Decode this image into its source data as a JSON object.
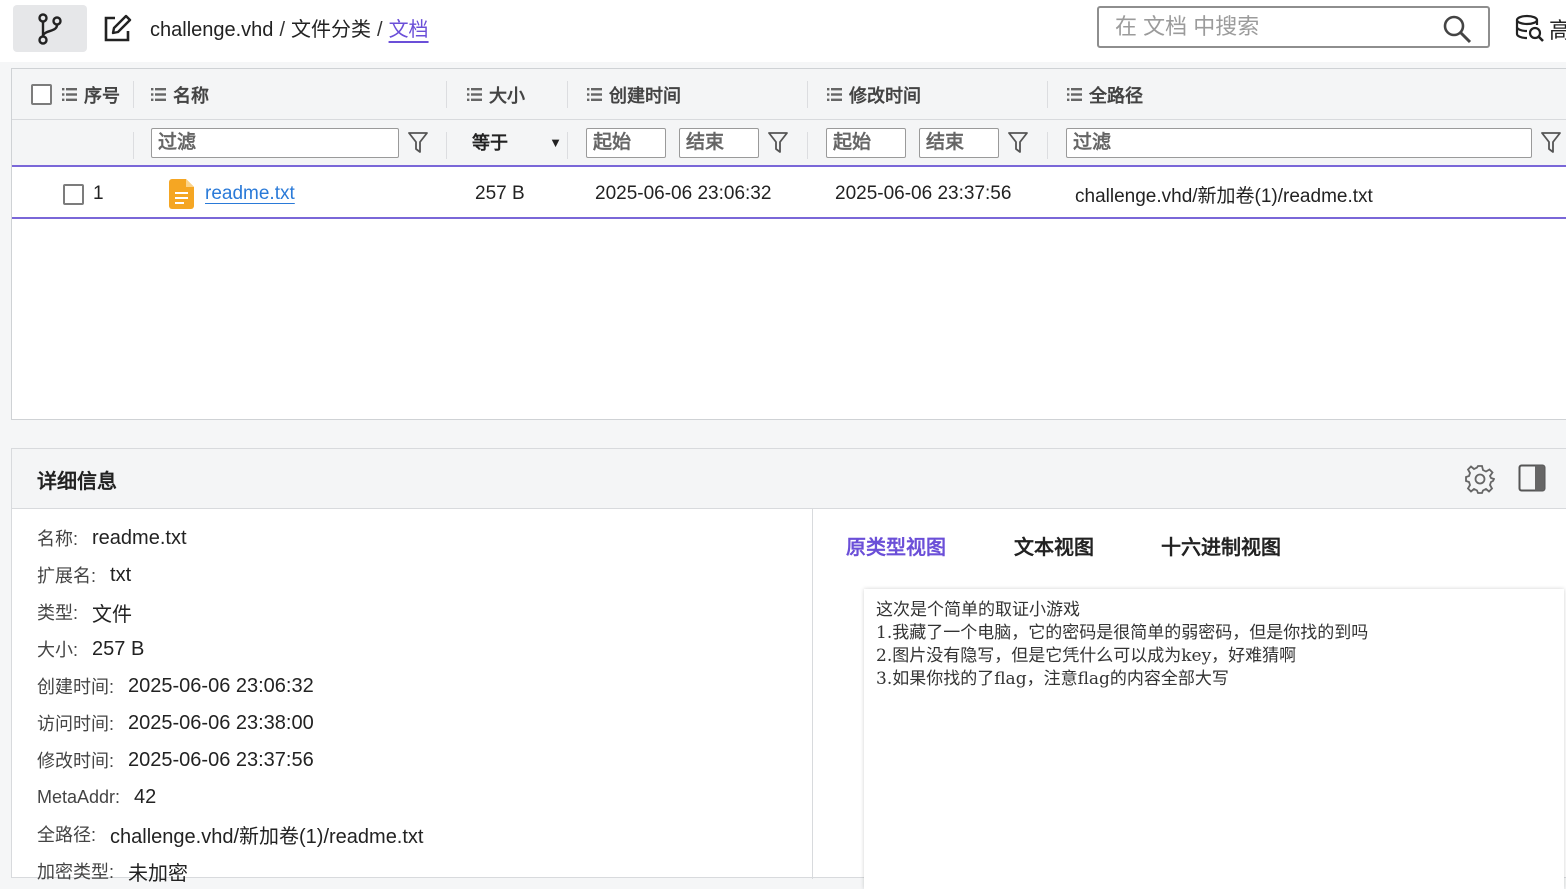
{
  "toolbar": {
    "branch_icon": "git-branch-icon",
    "edit_icon": "edit-icon"
  },
  "breadcrumb": {
    "items": [
      "challenge.vhd",
      "文件分类",
      "文档"
    ],
    "separator": "/"
  },
  "search": {
    "placeholder": "在 文档 中搜索",
    "advanced_label": "高"
  },
  "table": {
    "columns": [
      "序号",
      "名称",
      "大小",
      "创建时间",
      "修改时间",
      "全路径"
    ],
    "filters": {
      "name_placeholder": "过滤",
      "size_operator": "等于",
      "start_placeholder": "起始",
      "end_placeholder": "结束",
      "path_placeholder": "过滤"
    },
    "rows": [
      {
        "index": "1",
        "name": "readme.txt",
        "size": "257 B",
        "created": "2025-06-06 23:06:32",
        "modified": "2025-06-06 23:37:56",
        "path": "challenge.vhd/新加卷(1)/readme.txt"
      }
    ]
  },
  "detail": {
    "title": "详细信息",
    "props": [
      {
        "key": "名称:",
        "value": "readme.txt"
      },
      {
        "key": "扩展名:",
        "value": "txt"
      },
      {
        "key": "类型:",
        "value": "文件"
      },
      {
        "key": "大小:",
        "value": "257 B"
      },
      {
        "key": "创建时间:",
        "value": "2025-06-06 23:06:32"
      },
      {
        "key": "访问时间:",
        "value": "2025-06-06 23:38:00"
      },
      {
        "key": "修改时间:",
        "value": "2025-06-06 23:37:56"
      },
      {
        "key": "MetaAddr:",
        "value": "42"
      },
      {
        "key": "全路径:",
        "value": "challenge.vhd/新加卷(1)/readme.txt"
      },
      {
        "key": "加密类型:",
        "value": "未加密"
      }
    ],
    "tabs": [
      "原类型视图",
      "文本视图",
      "十六进制视图"
    ],
    "active_tab": 0,
    "content_lines": [
      "这次是个简单的取证小游戏",
      "1.我藏了一个电脑，它的密码是很简单的弱密码，但是你找的到吗",
      "2.图片没有隐写，但是它凭什么可以成为key，好难猜啊",
      "3.如果你找的了flag，注意flag的内容全部大写"
    ]
  },
  "colors": {
    "accent": "#6b4fd8",
    "link": "#2a7ad8",
    "file_icon": "#f5a623"
  }
}
